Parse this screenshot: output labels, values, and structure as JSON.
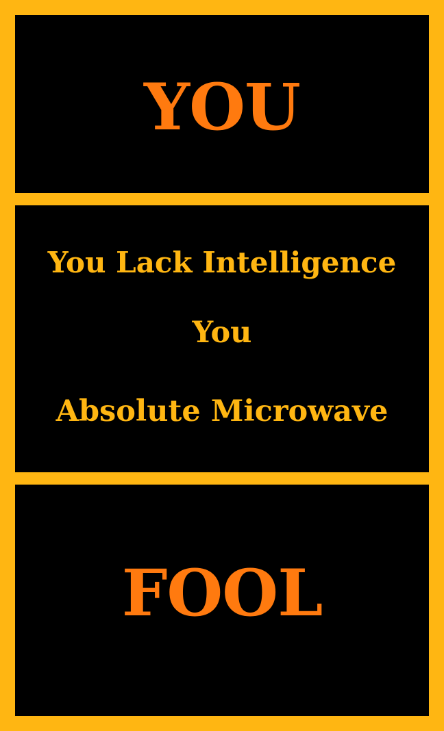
{
  "colors": {
    "background": "#ffb612",
    "panel": "#000000",
    "big_text": "#ff7a0f",
    "small_text": "#ffb612"
  },
  "top": {
    "word": "YOU"
  },
  "middle": {
    "lines": [
      "You Lack Intelligence",
      "You",
      "Absolute Microwave"
    ]
  },
  "bottom": {
    "word": "FOOL"
  }
}
